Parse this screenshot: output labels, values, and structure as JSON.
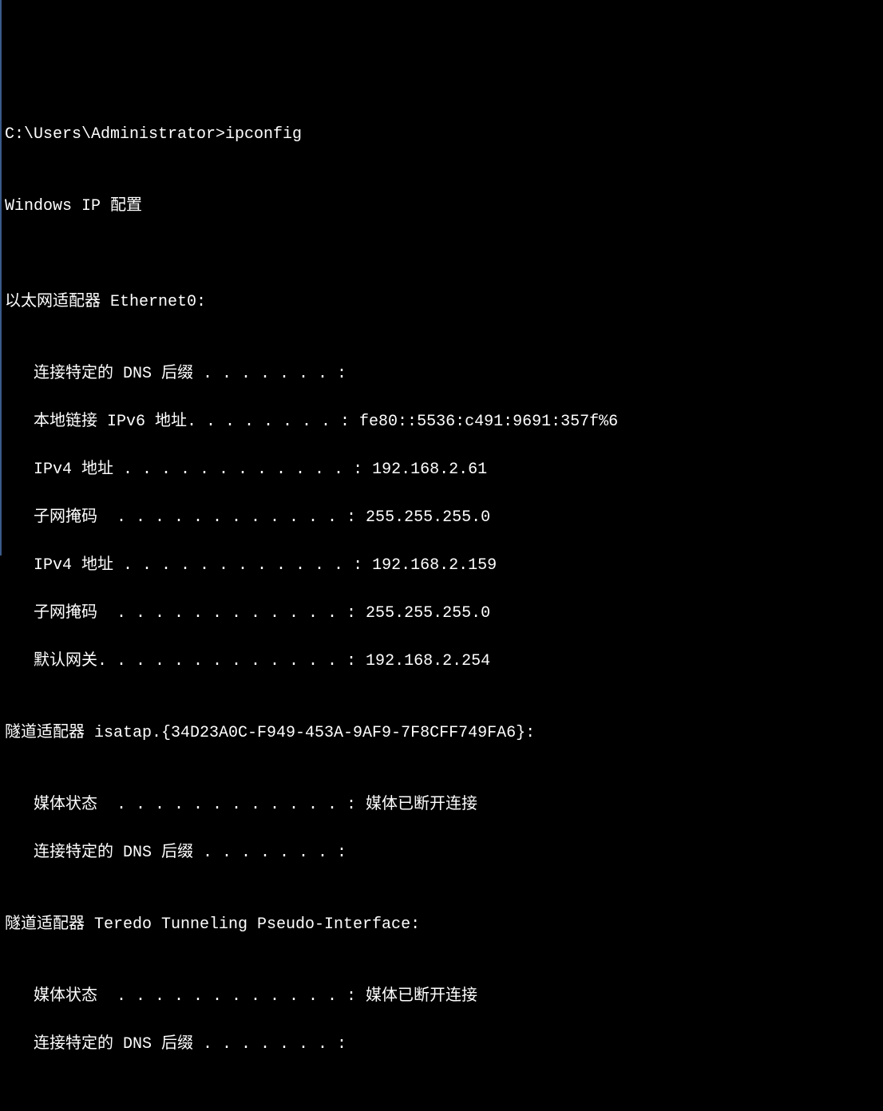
{
  "terminal": {
    "prompt_line": "C:\\Users\\Administrator>ipconfig",
    "blank": "",
    "header": "Windows IP 配置",
    "adapter1": {
      "title": "以太网适配器 Ethernet0:",
      "dns_suffix": "   连接特定的 DNS 后缀 . . . . . . . :",
      "ipv6_link_local": "   本地链接 IPv6 地址. . . . . . . . : fe80::5536:c491:9691:357f%6",
      "ipv4_addr1": "   IPv4 地址 . . . . . . . . . . . . : 192.168.2.61",
      "subnet1": "   子网掩码  . . . . . . . . . . . . : 255.255.255.0",
      "ipv4_addr2": "   IPv4 地址 . . . . . . . . . . . . : 192.168.2.159",
      "subnet2": "   子网掩码  . . . . . . . . . . . . : 255.255.255.0",
      "gateway": "   默认网关. . . . . . . . . . . . . : 192.168.2.254"
    },
    "adapter2": {
      "title": "隧道适配器 isatap.{34D23A0C-F949-453A-9AF9-7F8CFF749FA6}:",
      "media_state": "   媒体状态  . . . . . . . . . . . . : 媒体已断开连接",
      "dns_suffix": "   连接特定的 DNS 后缀 . . . . . . . :"
    },
    "adapter3": {
      "title": "隧道适配器 Teredo Tunneling Pseudo-Interface:",
      "media_state": "   媒体状态  . . . . . . . . . . . . : 媒体已断开连接",
      "dns_suffix": "   连接特定的 DNS 后缀 . . . . . . . :"
    }
  }
}
